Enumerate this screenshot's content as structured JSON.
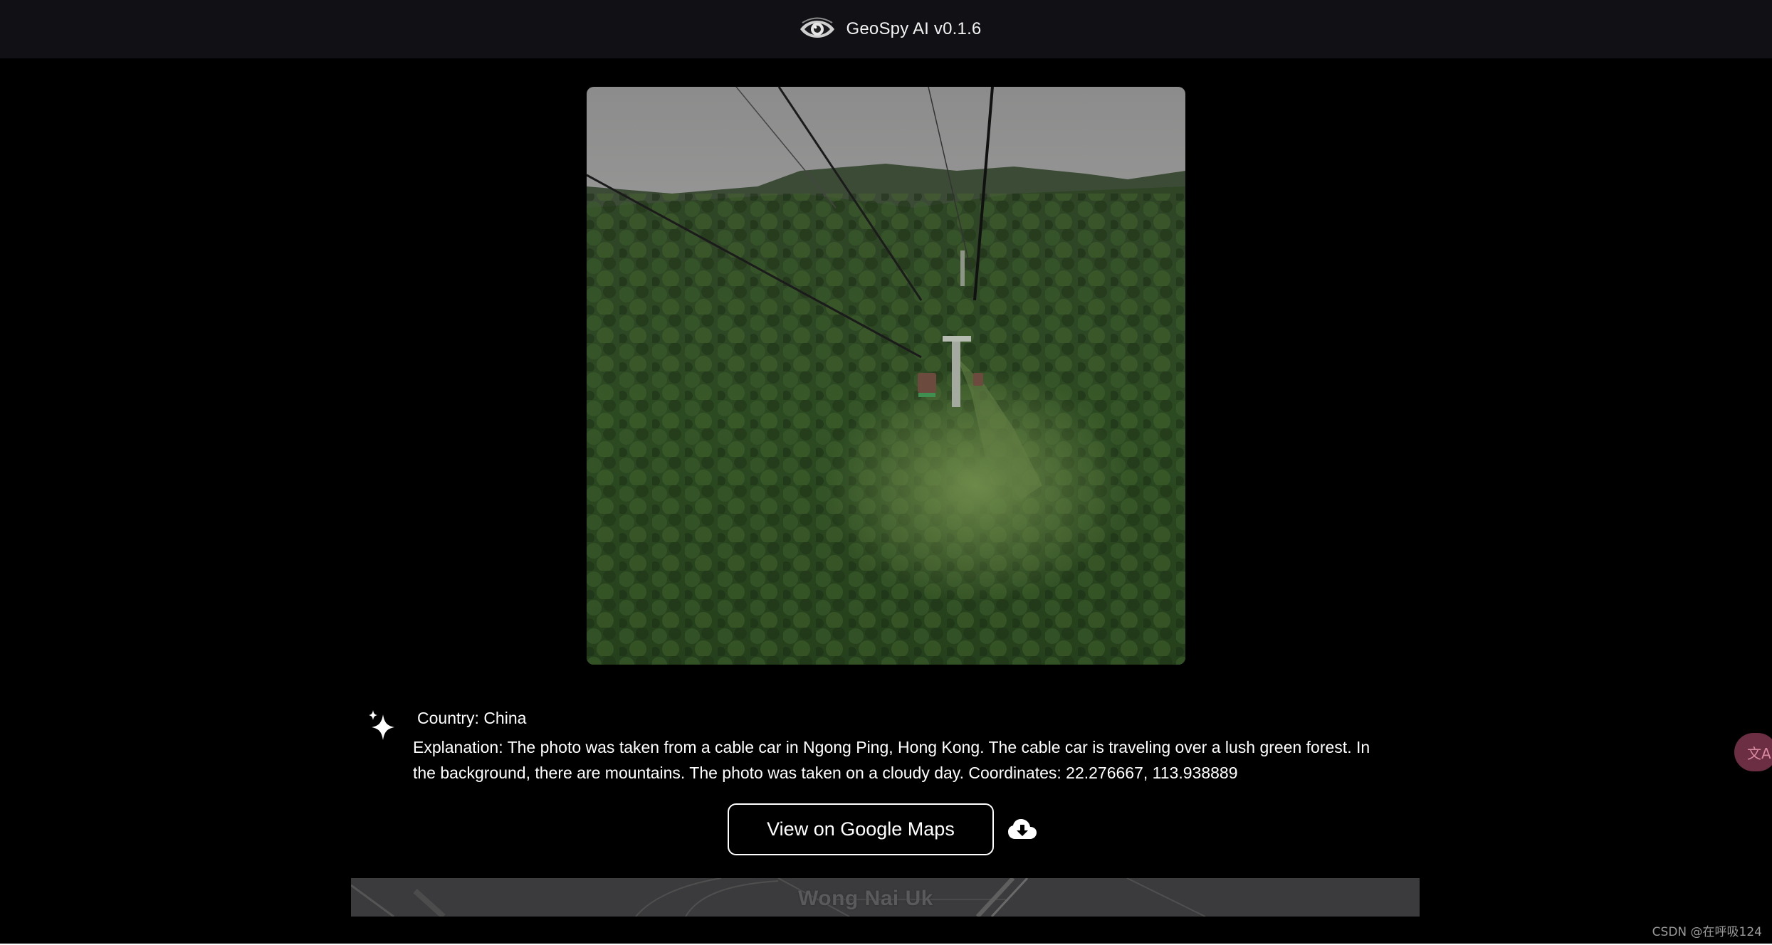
{
  "header": {
    "app_title": "GeoSpy AI v0.1.6",
    "logo_icon": "eye-icon"
  },
  "photo": {
    "description_icon": "uploaded-photo"
  },
  "result": {
    "icon": "sparkle-icon",
    "country_line": "Country: China",
    "explanation": "Explanation: The photo was taken from a cable car in Ngong Ping, Hong Kong. The cable car is traveling over a lush green forest. In the background, there are mountains. The photo was taken on a cloudy day. Coordinates: 22.276667, 113.938889"
  },
  "actions": {
    "maps_button_label": "View on Google Maps",
    "download_icon": "cloud-download-icon"
  },
  "map": {
    "place_label": "Wong Nai Uk"
  },
  "overlay": {
    "translate_glyph": "文A",
    "watermark": "CSDN @在呼吸124"
  },
  "colors": {
    "background": "#000000",
    "topbar": "#111015",
    "map_tile": "#3b3b3d",
    "translate_fab": "#6b2e43"
  }
}
